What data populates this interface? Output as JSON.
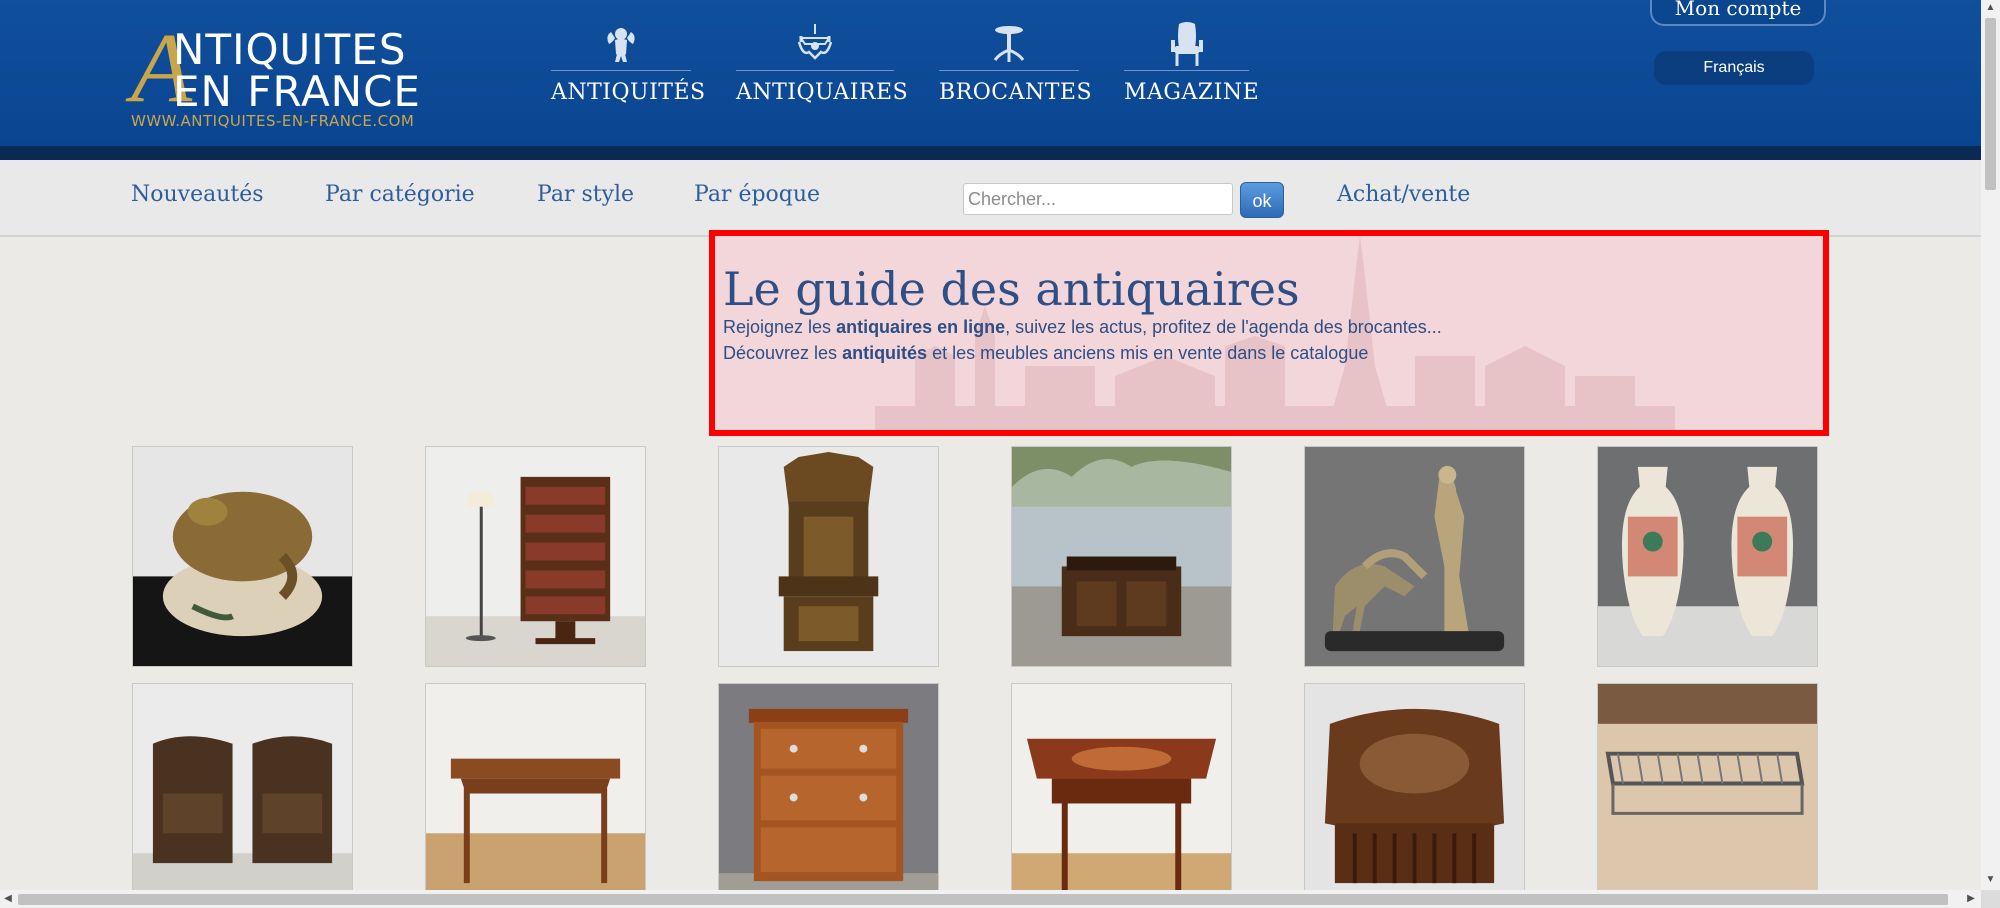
{
  "logo": {
    "big_letter": "A",
    "line1": "NTIQUITES",
    "line2": "EN FRANCE",
    "url": "WWW.ANTIQUITES-EN-FRANCE.COM"
  },
  "topnav": [
    {
      "label": "ANTIQUITÉS",
      "icon": "cherub-icon"
    },
    {
      "label": "ANTIQUAIRES",
      "icon": "chandelier-icon"
    },
    {
      "label": "BROCANTES",
      "icon": "gueridon-table-icon"
    },
    {
      "label": "MAGAZINE",
      "icon": "armchair-icon"
    }
  ],
  "account": {
    "label": "Mon compte"
  },
  "language": {
    "label": "Français"
  },
  "subnav": {
    "items": [
      "Nouveautés",
      "Par catégorie",
      "Par style",
      "Par époque"
    ],
    "search_placeholder": "Chercher...",
    "search_button": "ok",
    "sell_link": "Achat/vente"
  },
  "hero": {
    "title": "Le guide des antiquaires",
    "line1_pre": "Rejoignez les ",
    "line1_bold": "antiquaires en ligne",
    "line1_post": ", suivez les actus, profitez de l'agenda des brocantes...",
    "line2_pre": "Découvrez les ",
    "line2_bold": "antiquités",
    "line2_post": " et les meubles anciens mis en vente dans le catalogue"
  },
  "colors": {
    "header_blue": "#0b4a96",
    "gold": "#c9a64a",
    "link_blue": "#2c5d9c",
    "highlight_red": "#ff0000"
  },
  "products": [
    {
      "name": "bronze-frog-sculpture"
    },
    {
      "name": "revolving-bookcase"
    },
    {
      "name": "gothic-throne-chair"
    },
    {
      "name": "carved-oak-chest"
    },
    {
      "name": "art-deco-dancer-greyhounds"
    },
    {
      "name": "canton-porcelain-vases"
    },
    {
      "name": "pair-leather-club-chairs"
    },
    {
      "name": "cherrywood-writing-table"
    },
    {
      "name": "walnut-chest-of-drawers"
    },
    {
      "name": "inlaid-side-table"
    },
    {
      "name": "marquetry-sewing-box"
    },
    {
      "name": "brass-luggage-rack"
    }
  ]
}
